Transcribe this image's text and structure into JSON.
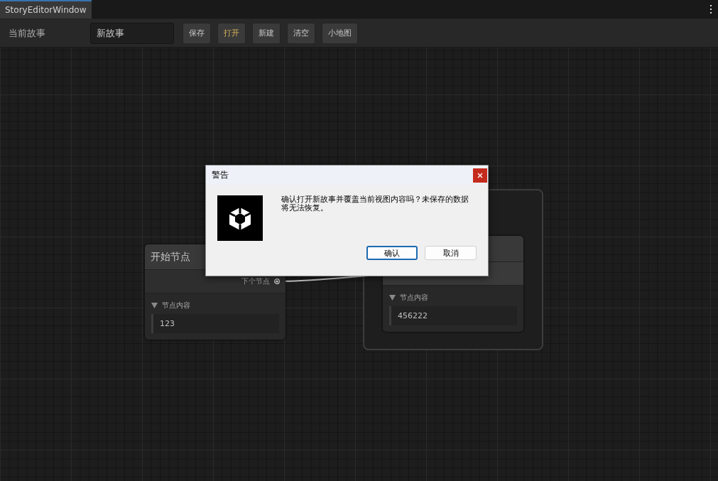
{
  "window": {
    "tab_title": "StoryEditorWindow"
  },
  "toolbar": {
    "label": "当前故事",
    "story_field": {
      "value": "新故事"
    },
    "buttons": [
      {
        "label": "保存",
        "active": false
      },
      {
        "label": "打开",
        "active": true
      },
      {
        "label": "新建",
        "active": false
      },
      {
        "label": "清空",
        "active": false
      },
      {
        "label": "小地图",
        "active": false
      }
    ]
  },
  "canvas": {
    "nodes": [
      {
        "title": "开始节点",
        "ports": [
          {
            "kind": "output",
            "label": "下个节点"
          }
        ],
        "section": {
          "label": "节点内容",
          "expanded": true,
          "value": "123"
        }
      },
      {
        "ports": [
          {
            "kind": "input"
          }
        ],
        "section": {
          "label": "节点内容",
          "expanded": true,
          "value": "456222"
        }
      }
    ]
  },
  "dialog": {
    "title": "警告",
    "message": "确认打开新故事并覆盖当前视图内容吗？未保存的数据将无法恢复。",
    "buttons": [
      {
        "label": "确认",
        "focused": true
      },
      {
        "label": "取消",
        "focused": false
      }
    ]
  }
}
